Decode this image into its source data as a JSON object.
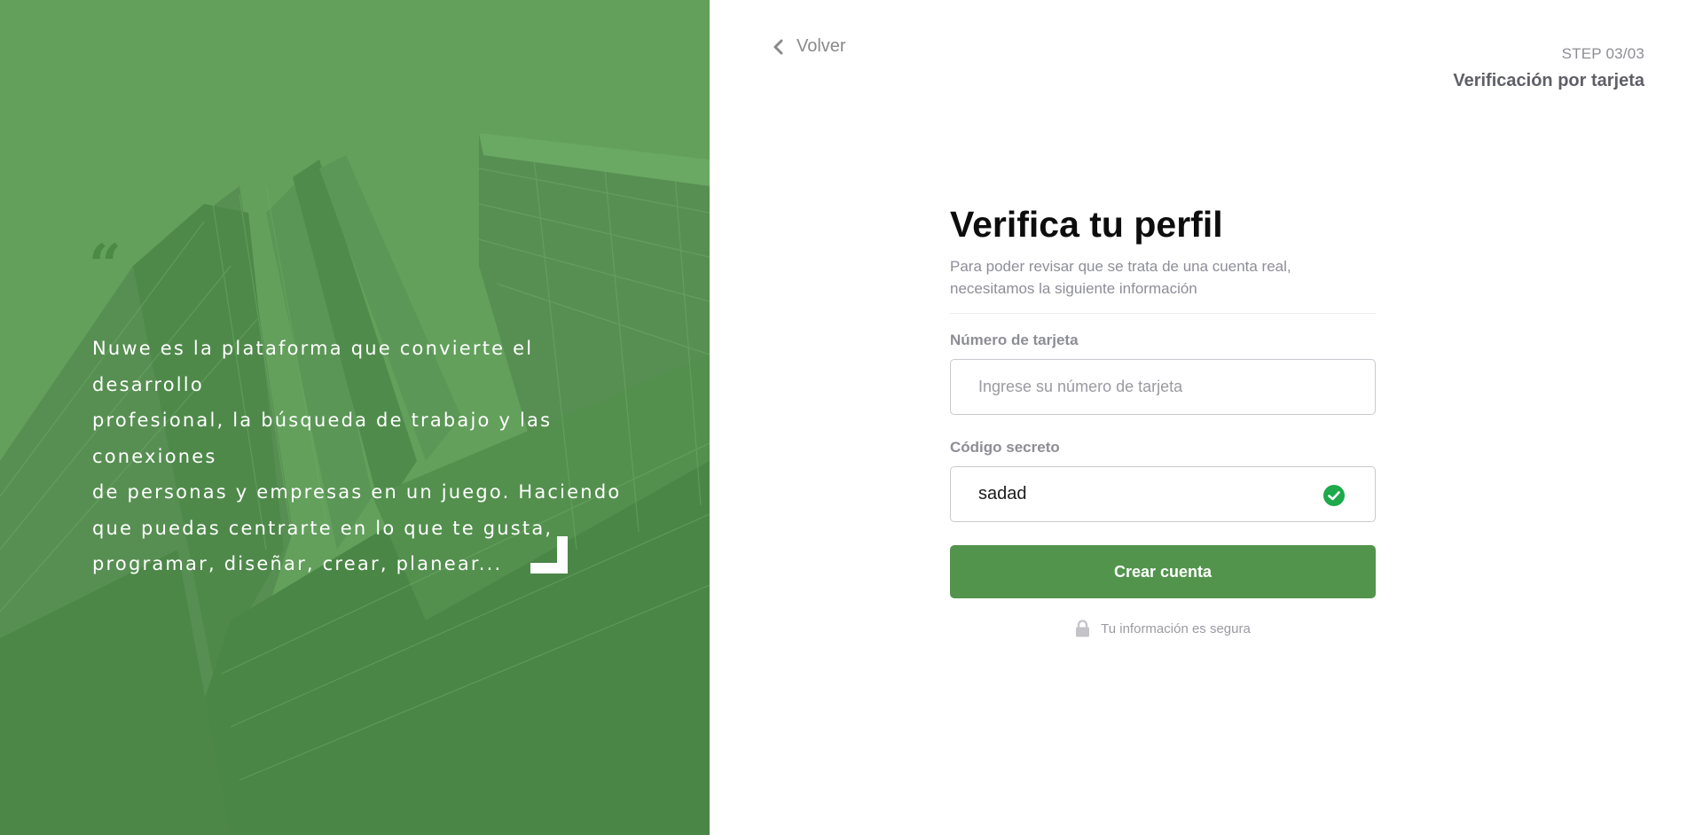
{
  "left_panel": {
    "quote_mark": "“",
    "quote_lines": [
      "Nuwe es la plataforma que convierte el desarrollo",
      "profesional, la búsqueda de trabajo y las conexiones",
      "de personas y empresas en un juego. Haciendo",
      "que puedas centrarte en lo que te gusta,",
      "programar, diseñar, crear, planear..."
    ],
    "background_color": "#5c9b57",
    "corner_icon": "corner-bracket-icon"
  },
  "header": {
    "back_label": "Volver",
    "back_icon": "chevron-left-icon",
    "step_number": "STEP 03/03",
    "step_title": "Verificación por tarjeta"
  },
  "form": {
    "title": "Verifica tu perfil",
    "subtitle_line1": "Para poder revisar que se trata de una cuenta real,",
    "subtitle_line2": "necesitamos la siguiente información",
    "card_label": "Número de tarjeta",
    "card_placeholder": "Ingrese su número de tarjeta",
    "card_value": "",
    "code_label": "Código secreto",
    "code_value": "sadad",
    "code_valid_icon": "check-circle-icon",
    "submit_label": "Crear cuenta",
    "secure_icon": "lock-icon",
    "secure_text": "Tu información es segura"
  },
  "colors": {
    "accent": "#52944c",
    "valid": "#1ea94a"
  }
}
